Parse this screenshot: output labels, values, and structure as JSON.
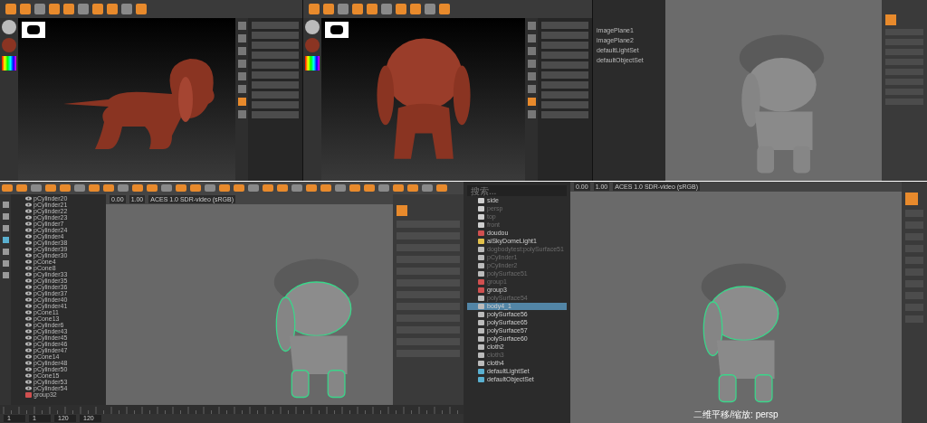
{
  "sculpt_views": [
    {
      "kind": "side"
    },
    {
      "kind": "back"
    }
  ],
  "top_maya": {
    "outliner_items": [
      "imagePlane1",
      "imagePlane2",
      "defaultLightSet",
      "defaultObjectSet"
    ]
  },
  "left_maya": {
    "outliner_items": [
      {
        "name": "pCylinder20",
        "kind": "mesh"
      },
      {
        "name": "pCylinder21",
        "kind": "mesh"
      },
      {
        "name": "pCylinder22",
        "kind": "mesh"
      },
      {
        "name": "pCylinder23",
        "kind": "mesh"
      },
      {
        "name": "pCylinder7",
        "kind": "mesh"
      },
      {
        "name": "pCylinder24",
        "kind": "mesh"
      },
      {
        "name": "pCylinder4",
        "kind": "mesh"
      },
      {
        "name": "pCylinder38",
        "kind": "mesh"
      },
      {
        "name": "pCylinder39",
        "kind": "mesh"
      },
      {
        "name": "pCylinder30",
        "kind": "mesh"
      },
      {
        "name": "pCone4",
        "kind": "mesh"
      },
      {
        "name": "pCone8",
        "kind": "mesh"
      },
      {
        "name": "pCylinder33",
        "kind": "mesh"
      },
      {
        "name": "pCylinder35",
        "kind": "mesh"
      },
      {
        "name": "pCylinder36",
        "kind": "mesh"
      },
      {
        "name": "pCylinder37",
        "kind": "mesh"
      },
      {
        "name": "pCylinder40",
        "kind": "mesh"
      },
      {
        "name": "pCylinder41",
        "kind": "mesh"
      },
      {
        "name": "pCone11",
        "kind": "mesh"
      },
      {
        "name": "pCone13",
        "kind": "mesh"
      },
      {
        "name": "pCylinder6",
        "kind": "mesh"
      },
      {
        "name": "pCylinder43",
        "kind": "mesh"
      },
      {
        "name": "pCylinder45",
        "kind": "mesh"
      },
      {
        "name": "pCylinder46",
        "kind": "mesh"
      },
      {
        "name": "pCylinder47",
        "kind": "mesh"
      },
      {
        "name": "pCone14",
        "kind": "mesh"
      },
      {
        "name": "pCylinder48",
        "kind": "mesh"
      },
      {
        "name": "pCylinder50",
        "kind": "mesh"
      },
      {
        "name": "pCone15",
        "kind": "mesh"
      },
      {
        "name": "pCylinder53",
        "kind": "mesh"
      },
      {
        "name": "pCylinder54",
        "kind": "mesh"
      },
      {
        "name": "group32",
        "kind": "group"
      }
    ],
    "color_space": "ACES 1.0 SDR-video (sRGB)",
    "exposure": "0.00",
    "gamma": "1.00",
    "frames": [
      "1",
      "1",
      "120",
      "120"
    ]
  },
  "outliner": {
    "search": {
      "placeholder": "搜索..."
    },
    "items": [
      {
        "name": "side",
        "kind": "camera",
        "dimmed": false,
        "selected": false
      },
      {
        "name": "persp",
        "kind": "camera",
        "dimmed": true,
        "selected": false
      },
      {
        "name": "top",
        "kind": "camera",
        "dimmed": true,
        "selected": false
      },
      {
        "name": "front",
        "kind": "camera",
        "dimmed": true,
        "selected": false
      },
      {
        "name": "doudou",
        "kind": "group",
        "dimmed": false,
        "selected": false
      },
      {
        "name": "aiSkyDomeLight1",
        "kind": "light",
        "dimmed": false,
        "selected": false
      },
      {
        "name": "dogbodytest:polySurface51",
        "kind": "mesh",
        "dimmed": true,
        "selected": false
      },
      {
        "name": "pCylinder1",
        "kind": "mesh",
        "dimmed": true,
        "selected": false
      },
      {
        "name": "pCylinder2",
        "kind": "mesh",
        "dimmed": true,
        "selected": false
      },
      {
        "name": "polySurface51",
        "kind": "mesh",
        "dimmed": true,
        "selected": false
      },
      {
        "name": "group1",
        "kind": "group",
        "dimmed": true,
        "selected": false
      },
      {
        "name": "group3",
        "kind": "group",
        "dimmed": false,
        "selected": false
      },
      {
        "name": "polySurface54",
        "kind": "mesh",
        "dimmed": true,
        "selected": false
      },
      {
        "name": "body4_1",
        "kind": "mesh",
        "dimmed": false,
        "selected": true
      },
      {
        "name": "polySurface56",
        "kind": "mesh",
        "dimmed": false,
        "selected": false
      },
      {
        "name": "polySurface65",
        "kind": "mesh",
        "dimmed": false,
        "selected": false
      },
      {
        "name": "polySurface57",
        "kind": "mesh",
        "dimmed": false,
        "selected": false
      },
      {
        "name": "polySurface60",
        "kind": "mesh",
        "dimmed": false,
        "selected": false
      },
      {
        "name": "cloth2",
        "kind": "mesh",
        "dimmed": false,
        "selected": false
      },
      {
        "name": "cloth3",
        "kind": "mesh",
        "dimmed": true,
        "selected": false
      },
      {
        "name": "cloth4",
        "kind": "mesh",
        "dimmed": false,
        "selected": false
      },
      {
        "name": "defaultLightSet",
        "kind": "set",
        "dimmed": false,
        "selected": false
      },
      {
        "name": "defaultObjectSet",
        "kind": "set",
        "dimmed": false,
        "selected": false
      }
    ]
  },
  "right_maya": {
    "color_space": "ACES 1.0 SDR-video (sRGB)",
    "exposure": "0.00",
    "gamma": "1.00",
    "camera_label": "二维平移/缩放: persp"
  }
}
